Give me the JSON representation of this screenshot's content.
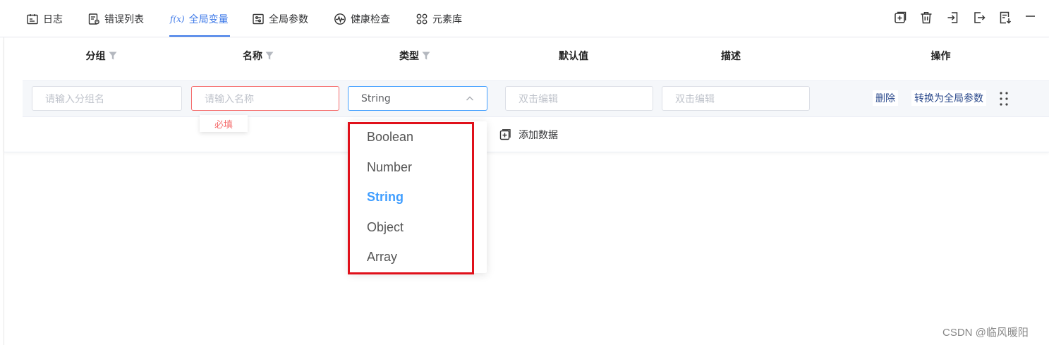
{
  "tabs": [
    {
      "label": "日志",
      "icon": "calendar-icon"
    },
    {
      "label": "错误列表",
      "icon": "error-list-icon"
    },
    {
      "label": "全局变量",
      "icon": "function-icon",
      "glyph": "f(x)",
      "active": true
    },
    {
      "label": "全局参数",
      "icon": "sliders-icon"
    },
    {
      "label": "健康检查",
      "icon": "heartbeat-icon"
    },
    {
      "label": "元素库",
      "icon": "grid-icon"
    }
  ],
  "toolbar": [
    "add-icon",
    "delete-icon",
    "import-icon",
    "export-icon",
    "download-icon",
    "minimize-icon"
  ],
  "table": {
    "columns": [
      {
        "label": "分组",
        "filter": true
      },
      {
        "label": "名称",
        "filter": true
      },
      {
        "label": "类型",
        "filter": true
      },
      {
        "label": "默认值",
        "filter": false
      },
      {
        "label": "描述",
        "filter": false
      },
      {
        "label": "操作",
        "filter": false
      }
    ],
    "row": {
      "group_placeholder": "请输入分组名",
      "name_placeholder": "请输入名称",
      "name_error": "必填",
      "type_value": "String",
      "default_placeholder": "双击编辑",
      "desc_placeholder": "双击编辑",
      "delete_label": "删除",
      "convert_label": "转换为全局参数"
    },
    "add_data_label": "添加数据"
  },
  "type_dropdown": {
    "options": [
      "Boolean",
      "Number",
      "String",
      "Object",
      "Array"
    ],
    "selected": "String"
  },
  "colors": {
    "accent": "#409eff",
    "tab_active": "#3c78e8",
    "error": "#f56c6c",
    "highlight": "#e0101a"
  },
  "watermark": "CSDN @临风暖阳"
}
